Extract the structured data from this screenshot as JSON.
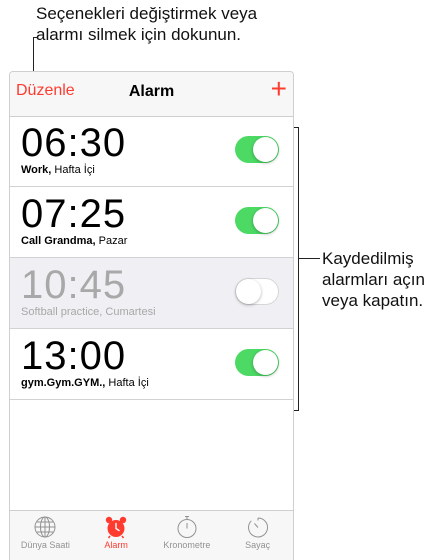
{
  "callouts": {
    "top_line1": "Seçenekleri değiştirmek veya",
    "top_line2": "alarmı silmek için dokunun.",
    "right_line1": "Kaydedilmiş",
    "right_line2": "alarmları açın",
    "right_line3": "veya kapatın."
  },
  "navbar": {
    "edit_label": "Düzenle",
    "title": "Alarm",
    "add_label": "+"
  },
  "alarms": [
    {
      "time": "06:30",
      "name": "Work,",
      "days": "Hafta İçi",
      "enabled": true
    },
    {
      "time": "07:25",
      "name": "Call Grandma,",
      "days": "Pazar",
      "enabled": true
    },
    {
      "time": "10:45",
      "name": "Softball practice,",
      "days": "Cumartesi",
      "enabled": false
    },
    {
      "time": "13:00",
      "name": "gym.Gym.GYM.,",
      "days": "Hafta İçi",
      "enabled": true
    }
  ],
  "tabs": [
    {
      "label": "Dünya Saati",
      "icon": "globe-icon",
      "active": false
    },
    {
      "label": "Alarm",
      "icon": "alarm-clock-icon",
      "active": true
    },
    {
      "label": "Kronometre",
      "icon": "stopwatch-icon",
      "active": false
    },
    {
      "label": "Sayaç",
      "icon": "timer-icon",
      "active": false
    }
  ],
  "colors": {
    "accent": "#ff3b30",
    "toggle_on": "#4cd964",
    "bar_bg": "#f7f7f7",
    "disabled_row": "#efeff4"
  }
}
